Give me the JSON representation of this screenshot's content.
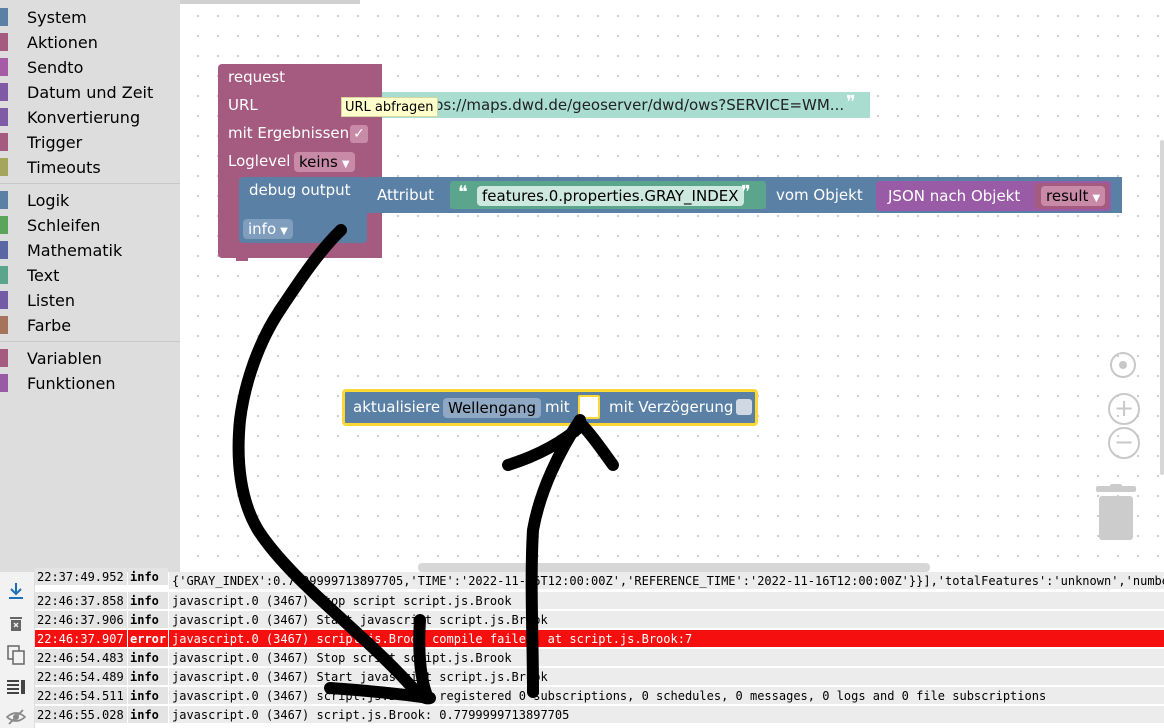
{
  "toolbox": {
    "categories": [
      {
        "label": "System",
        "color": "#5b80a5"
      },
      {
        "label": "Aktionen",
        "color": "#a55b80"
      },
      {
        "label": "Sendto",
        "color": "#a55ba5"
      },
      {
        "label": "Datum und Zeit",
        "color": "#805ba5"
      },
      {
        "label": "Konvertierung",
        "color": "#805ba5"
      },
      {
        "label": "Trigger",
        "color": "#a55b80"
      },
      {
        "label": "Timeouts",
        "color": "#a5a55b"
      },
      {
        "label": "Logik",
        "color": "#5b80a5"
      },
      {
        "label": "Schleifen",
        "color": "#5ba55b"
      },
      {
        "label": "Mathematik",
        "color": "#5b67a5"
      },
      {
        "label": "Text",
        "color": "#5ba58c"
      },
      {
        "label": "Listen",
        "color": "#745ba5"
      },
      {
        "label": "Farbe",
        "color": "#a5745b"
      },
      {
        "label": "Variablen",
        "color": "#a55b80"
      },
      {
        "label": "Funktionen",
        "color": "#995ba5"
      }
    ]
  },
  "request_block": {
    "title": "request",
    "url_label": "URL",
    "tooltip": "URL abfragen",
    "url_value": "tps://maps.dwd.de/geoserver/dwd/ows?SERVICE=WM...",
    "quote_close": "❞",
    "results_label": "mit Ergebnissen",
    "checkbox": "✓",
    "loglevel_label": "Loglevel",
    "loglevel_value": "keins"
  },
  "debug_block": {
    "title": "debug output",
    "level": "info",
    "attribute_label": "Attribut",
    "quote_open": "❝",
    "attribute_value": "features.0.properties.GRAY_INDEX",
    "quote_close": "❞",
    "object_label": "vom Objekt",
    "json_label": "JSON nach Objekt",
    "result_var": "result"
  },
  "update_block": {
    "label": "aktualisiere",
    "target": "Wellengang",
    "with_label": "mit",
    "delay_label": "mit Verzögerung"
  },
  "zoom": {
    "center": "◎",
    "plus": "+",
    "minus": "−"
  },
  "console": {
    "rows": [
      {
        "time": "22:37:49.952",
        "level": "info",
        "msg": "{'GRAY_INDEX':0.7799999713897705,'TIME':'2022-11-16T12:00:00Z','REFERENCE_TIME':'2022-11-16T12:00:00Z'}}],'totalFeatures':'unknown','numberReturned'",
        "error": false
      },
      {
        "time": "22:46:37.858",
        "level": "info",
        "msg": "javascript.0 (3467) Stop script script.js.Brook",
        "error": false
      },
      {
        "time": "22:46:37.906",
        "level": "info",
        "msg": "javascript.0 (3467) Start javascript script.js.Brook",
        "error": false
      },
      {
        "time": "22:46:37.907",
        "level": "error",
        "msg": "javascript.0 (3467) script.js.Brook compile failed: at script.js.Brook:7",
        "error": true
      },
      {
        "time": "22:46:54.483",
        "level": "info",
        "msg": "javascript.0 (3467) Stop script script.js.Brook",
        "error": false
      },
      {
        "time": "22:46:54.489",
        "level": "info",
        "msg": "javascript.0 (3467) Start javascript script.js.Brook",
        "error": false
      },
      {
        "time": "22:46:54.511",
        "level": "info",
        "msg": "javascript.0 (3467) script.js.Brook: registered 0 subscriptions, 0 schedules, 0 messages, 0 logs and 0 file subscriptions",
        "error": false
      },
      {
        "time": "22:46:55.028",
        "level": "info",
        "msg": "javascript.0 (3467) script.js.Brook: 0.7799999713897705",
        "error": false
      }
    ]
  },
  "colors": {
    "request": "#a55b80",
    "debug": "#5b80a5",
    "text": "#5ba58c",
    "json": "#995ba5",
    "error_row": "#f60f0f",
    "select_highlight": "#fdd835"
  }
}
